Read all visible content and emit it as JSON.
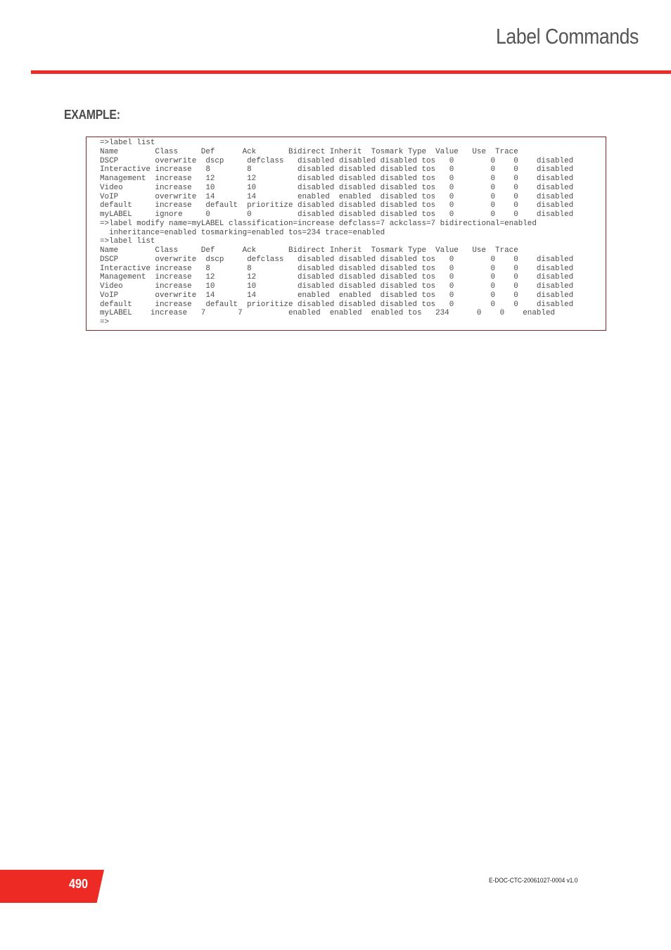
{
  "header": {
    "chapter_title": "Label Commands",
    "accent_color": "#ee2a24"
  },
  "section": {
    "heading": "EXAMPLE:"
  },
  "terminal": {
    "lines": [
      "=>label list",
      "Name        Class     Def      Ack       Bidirect Inherit  Tosmark Type  Value   Use  Trace",
      "DSCP        overwrite  dscp     defclass   disabled disabled disabled tos   0        0    0    disabled",
      "Interactive increase   8        8          disabled disabled disabled tos   0        0    0    disabled",
      "Management  increase   12       12         disabled disabled disabled tos   0        0    0    disabled",
      "Video       increase   10       10         disabled disabled disabled tos   0        0    0    disabled",
      "VoIP        overwrite  14       14         enabled  enabled  disabled tos   0        0    0    disabled",
      "default     increase   default  prioritize disabled disabled disabled tos   0        0    0    disabled",
      "myLABEL     ignore     0        0          disabled disabled disabled tos   0        0    0    disabled",
      "=>label modify name=myLABEL classification=increase defclass=7 ackclass=7 bidirectional=enabled",
      "  inheritance=enabled tosmarking=enabled tos=234 trace=enabled",
      "=>label list",
      "Name        Class     Def      Ack       Bidirect Inherit  Tosmark Type  Value   Use  Trace",
      "DSCP        overwrite  dscp     defclass   disabled disabled disabled tos   0        0    0    disabled",
      "Interactive increase   8        8          disabled disabled disabled tos   0        0    0    disabled",
      "Management  increase   12       12         disabled disabled disabled tos   0        0    0    disabled",
      "Video       increase   10       10         disabled disabled disabled tos   0        0    0    disabled",
      "VoIP        overwrite  14       14         enabled  enabled  disabled tos   0        0    0    disabled",
      "default     increase   default  prioritize disabled disabled disabled tos   0        0    0    disabled",
      "myLABEL    increase   7       7          enabled  enabled  enabled tos   234      0    0    enabled",
      "=>"
    ]
  },
  "footer": {
    "page_number": "490",
    "doc_id": "E-DOC-CTC-20061027-0004 v1.0"
  }
}
